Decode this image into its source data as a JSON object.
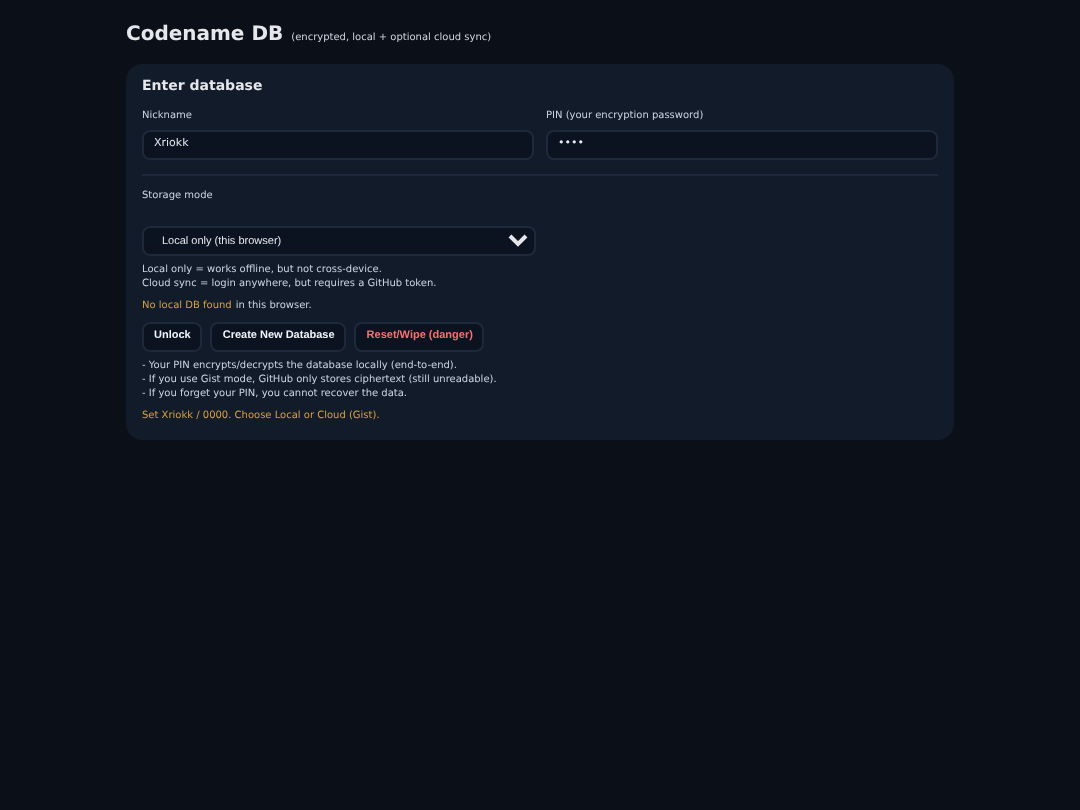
{
  "header": {
    "title": "Codename DB",
    "subtitle": "(encrypted, local + optional cloud sync)"
  },
  "card": {
    "title": "Enter database",
    "fields": [
      {
        "label": "Nickname",
        "value": "Xriokk"
      },
      {
        "label": "PIN (your encryption password)",
        "value": "••••"
      }
    ],
    "storage": {
      "label": "Storage mode",
      "value": "Local only (this browser)"
    },
    "help_lines": [
      "Local only = works offline, but not cross-device.",
      "Cloud sync = login anywhere, but requires a GitHub token."
    ],
    "db_status": {
      "highlight": "No local DB found",
      "rest": "in this browser."
    },
    "buttons": [
      {
        "label": "Unlock",
        "kind": "normal"
      },
      {
        "label": "Create New Database",
        "kind": "normal"
      },
      {
        "label": "Reset/Wipe (danger)",
        "kind": "danger"
      }
    ],
    "notes": [
      "- Your PIN encrypts/decrypts the database locally (end-to-end).",
      "- If you use Gist mode, GitHub only stores ciphertext (still unreadable).",
      "- If you forget your PIN, you cannot recover the data."
    ],
    "message": "Set Xriokk / 0000. Choose Local or Cloud (Gist)."
  }
}
